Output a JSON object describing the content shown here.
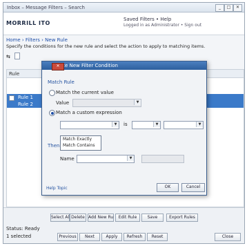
{
  "window": {
    "title": "Inbox – Message Filters – Search"
  },
  "header": {
    "brand": "MORRILL ITO",
    "right_line1": "Saved Filters • Help",
    "right_line2": "Logged in as Administrator • Sign out"
  },
  "breadcrumb": "Home › Filters › New Rule",
  "instructions": "Specify the conditions for the new rule and select the action to apply to matching items.",
  "table": {
    "header": "Rule",
    "rows": [
      "Rule 1",
      "Rule 2"
    ]
  },
  "dialog": {
    "title": "Create New Filter Condition",
    "section_label": "Match Rule",
    "radio1_label": "Match the current value",
    "value_label": "Value",
    "radio2_label": "Match a custom expression",
    "operator_label": "is",
    "dropdown_options": [
      "Match Exactly",
      "Match Contains"
    ],
    "section2_label": "Then",
    "name_label": "Name",
    "help_link": "Help Topic",
    "ok_label": "OK",
    "cancel_label": "Cancel"
  },
  "bottom_buttons": [
    "Select All",
    "Delete",
    "Add New Rule",
    "Edit Rule",
    "Save",
    "Export Rules"
  ],
  "bottom_row2": [
    "Previous",
    "Next",
    "Apply",
    "Refresh",
    "Reset",
    "Close"
  ],
  "status": {
    "label": "Status: Ready",
    "value": "1 selected"
  }
}
